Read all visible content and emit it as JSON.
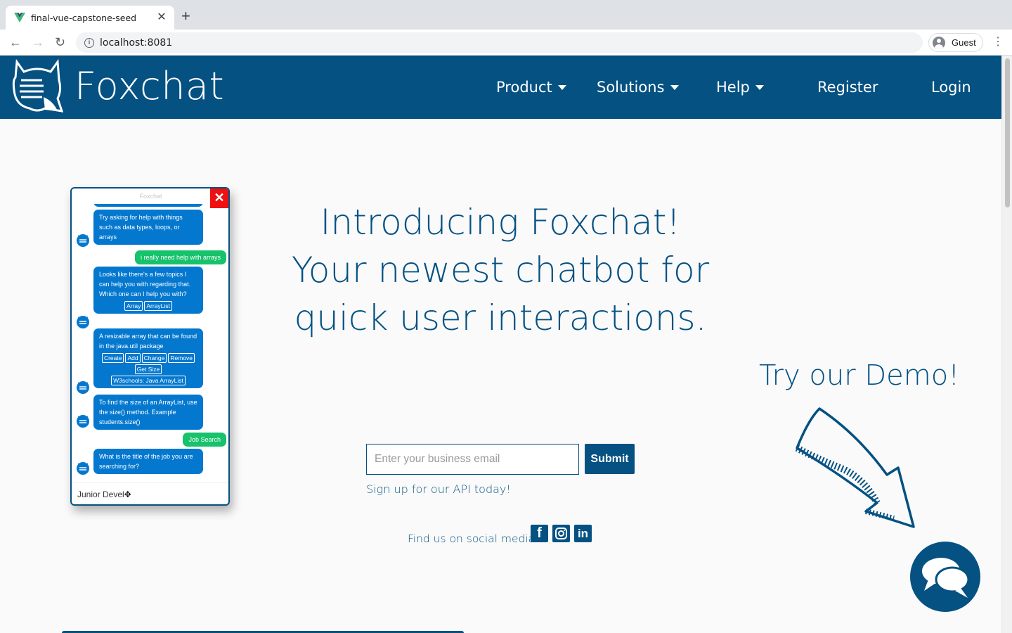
{
  "browser": {
    "tab_title": "final-vue-capstone-seed",
    "tab_close": "✕",
    "new_tab": "+",
    "url": "localhost:8081",
    "profile_label": "Guest",
    "back": "←",
    "forward": "→",
    "reload": "↻",
    "menu": "⋮"
  },
  "header": {
    "brand": "Foxchat",
    "nav": [
      "Product",
      "Solutions",
      "Help",
      "Register",
      "Login"
    ]
  },
  "chat": {
    "title": "Foxchat",
    "close": "✕",
    "messages": [
      {
        "from": "bot",
        "text": "Try asking for help with things such as data types, loops, or arrays"
      },
      {
        "from": "user",
        "text": "i really need help with arrays"
      },
      {
        "from": "bot",
        "text": "Looks like there's a few topics I can help you with regarding that. Which one can I help you with?",
        "chips": [
          "Array",
          "ArrayList"
        ]
      },
      {
        "from": "bot",
        "text": "A resizable array that can be found in the java.util package",
        "chips": [
          "Create",
          "Add",
          "Change",
          "Remove",
          "Get Size",
          "W3schools: Java ArrayList"
        ]
      },
      {
        "from": "bot",
        "text": "To find the size of an ArrayList, use the size() method. Example students.size()"
      },
      {
        "from": "user",
        "text": "Job Search"
      },
      {
        "from": "bot",
        "text": "What is the title of the job you are searching for?"
      }
    ],
    "input_value": "Junior Devel"
  },
  "hero": {
    "line1": "Introducing Foxchat!",
    "line2": "Your newest chatbot for",
    "line3": "quick user interactions."
  },
  "demo": {
    "title": "Try our Demo!"
  },
  "signup": {
    "placeholder": "Enter your business email",
    "submit": "Submit",
    "caption": "Sign up for our API today!"
  },
  "social": {
    "label": "Find us on social media",
    "icons": [
      "facebook-icon",
      "instagram-icon",
      "linkedin-icon"
    ]
  },
  "colors": {
    "brand": "#045182",
    "bot_bubble": "#0478cf",
    "user_bubble": "#16c26b",
    "close_red": "#e11111"
  }
}
